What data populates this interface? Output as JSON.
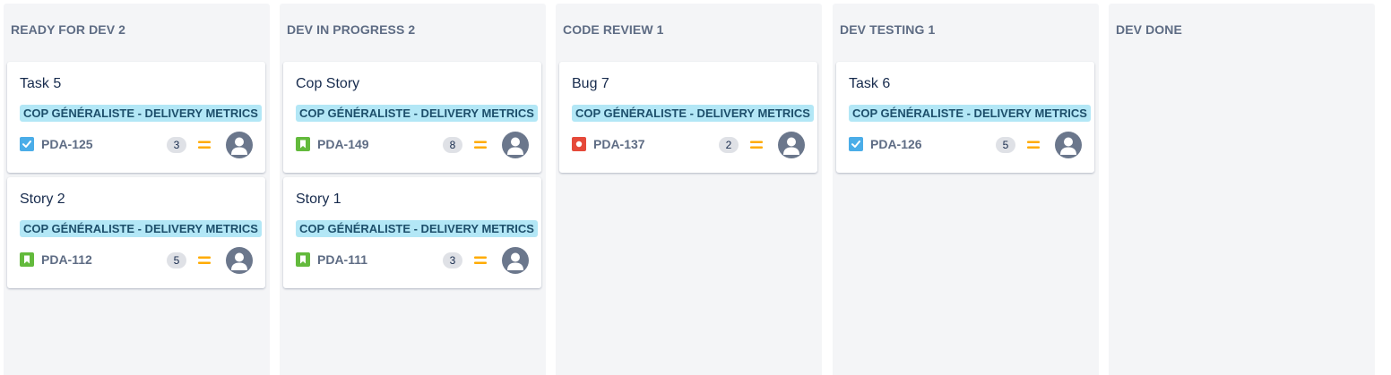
{
  "board": {
    "columns": [
      {
        "name": "READY FOR DEV",
        "count": "2",
        "cards": [
          {
            "title": "Task 5",
            "epic": "COP GÉNÉRALISTE - DELIVERY METRICS",
            "type": "task",
            "type_icon": "task-checkbox-icon",
            "key": "PDA-125",
            "estimate": "3",
            "priority_icon": "priority-medium-icon",
            "avatar": "unassigned-avatar"
          },
          {
            "title": "Story 2",
            "epic": "COP GÉNÉRALISTE - DELIVERY METRICS",
            "type": "story",
            "type_icon": "story-bookmark-icon",
            "key": "PDA-112",
            "estimate": "5",
            "priority_icon": "priority-medium-icon",
            "avatar": "unassigned-avatar"
          }
        ]
      },
      {
        "name": "DEV IN PROGRESS",
        "count": "2",
        "cards": [
          {
            "title": "Cop Story",
            "epic": "COP GÉNÉRALISTE - DELIVERY METRICS",
            "type": "story",
            "type_icon": "story-bookmark-icon",
            "key": "PDA-149",
            "estimate": "8",
            "priority_icon": "priority-medium-icon",
            "avatar": "unassigned-avatar"
          },
          {
            "title": "Story 1",
            "epic": "COP GÉNÉRALISTE - DELIVERY METRICS",
            "type": "story",
            "type_icon": "story-bookmark-icon",
            "key": "PDA-111",
            "estimate": "3",
            "priority_icon": "priority-medium-icon",
            "avatar": "unassigned-avatar"
          }
        ]
      },
      {
        "name": "CODE REVIEW",
        "count": "1",
        "cards": [
          {
            "title": "Bug 7",
            "epic": "COP GÉNÉRALISTE - DELIVERY METRICS",
            "type": "bug",
            "type_icon": "bug-icon",
            "key": "PDA-137",
            "estimate": "2",
            "priority_icon": "priority-medium-icon",
            "avatar": "unassigned-avatar"
          }
        ]
      },
      {
        "name": "DEV TESTING",
        "count": "1",
        "cards": [
          {
            "title": "Task 6",
            "epic": "COP GÉNÉRALISTE - DELIVERY METRICS",
            "type": "task",
            "type_icon": "task-checkbox-icon",
            "key": "PDA-126",
            "estimate": "5",
            "priority_icon": "priority-medium-icon",
            "avatar": "unassigned-avatar"
          }
        ]
      },
      {
        "name": "DEV DONE",
        "count": "",
        "cards": []
      }
    ]
  },
  "colors": {
    "column_bg": "#f4f5f7",
    "epic_bg": "#b3e7f6",
    "epic_text": "#1d4f6b",
    "task": "#4bade8",
    "story": "#63ba3c",
    "bug": "#e5493a",
    "priority_medium": "#ffab00",
    "avatar": "#6b778c"
  }
}
